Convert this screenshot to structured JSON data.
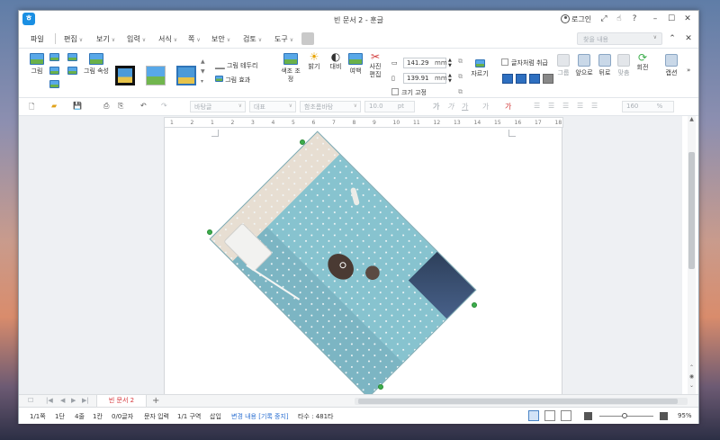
{
  "titlebar": {
    "logo_letter": "ㅎ",
    "document_title": "빈 문서 2 - 훈글",
    "login_label": "로그인",
    "help_glyph": "?"
  },
  "menubar": {
    "items": [
      {
        "label": "파일",
        "chevron": false
      },
      {
        "label": "편집",
        "chevron": true
      },
      {
        "label": "보기",
        "chevron": true
      },
      {
        "label": "입력",
        "chevron": true
      },
      {
        "label": "서식",
        "chevron": true
      },
      {
        "label": "쪽",
        "chevron": true
      },
      {
        "label": "보안",
        "chevron": true
      },
      {
        "label": "검토",
        "chevron": true
      },
      {
        "label": "도구",
        "chevron": true
      }
    ],
    "chevron_glyph": "∨",
    "search_placeholder": "찾을 내용"
  },
  "ribbon": {
    "picture": "그림",
    "picture_props": "그림 속성",
    "picture_border": "그림 테두리",
    "picture_effect": "그림 효과",
    "color_adjust": "색조 조정",
    "brightness": "밝기",
    "contrast": "대비",
    "margin": "여백",
    "photo_edit": "사진 편집",
    "width_value": "141.29",
    "height_value": "139.91",
    "unit": "mm",
    "lock_size": "크기 고정",
    "crop": "자르기",
    "cancel_text_wrap": "글자처럼 취급",
    "group": "그룹",
    "bring_forward": "앞으로",
    "send_backward": "뒤로",
    "align": "맞춤",
    "rotate": "회전",
    "caption": "캡션",
    "more_glyph": "»"
  },
  "toolbar": {
    "style": "바탕글",
    "representative": "대표",
    "font": "함초롬바탕",
    "size": "10.0",
    "size_unit": "pt",
    "zoom_value": "160",
    "zoom_unit": "%"
  },
  "ruler": {
    "ticks": [
      "1",
      "2",
      "1",
      "2",
      "3",
      "4",
      "5",
      "6",
      "7",
      "8",
      "9",
      "10",
      "11",
      "12",
      "13",
      "14",
      "15",
      "16",
      "17",
      "18"
    ]
  },
  "tabs": {
    "doc_tab": "빈 문서 2",
    "add_glyph": "+"
  },
  "status": {
    "page": "1/1쪽",
    "column": "1단",
    "line": "4줄",
    "col": "1칸",
    "chars": "0/0글자",
    "input_mode": "문자 입력",
    "section": "1/1 구역",
    "insert": "삽입",
    "track_changes": "변경 내용 [기록 중지]",
    "keystrokes": "타수 : 481타",
    "zoom": "95%"
  }
}
